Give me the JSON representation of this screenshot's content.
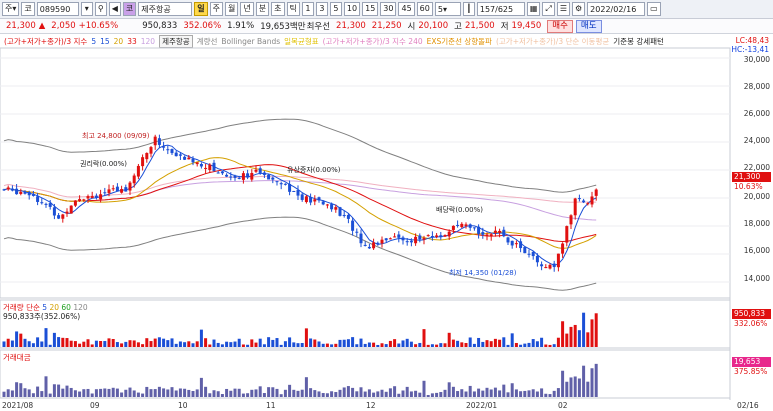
{
  "toolbar": {
    "market": "주",
    "code_prefix": "코",
    "code": "089590",
    "search_icon": "search-icon",
    "sound_icon": "speaker-icon",
    "badge": "코",
    "name": "제주항공",
    "periods": [
      "일",
      "주",
      "월",
      "년",
      "분",
      "초",
      "틱"
    ],
    "active_period": "일",
    "intervals": [
      "1",
      "3",
      "5",
      "10",
      "15",
      "30",
      "45",
      "60"
    ],
    "interval_value": "5",
    "count": "157/625",
    "date": "2022/02/16"
  },
  "infobar": {
    "price": "21,300",
    "change": "▲",
    "change_value": "2,050",
    "change_pct": "+10.65%",
    "volume": "950,833",
    "vol_pct": "352.06%",
    "turnover": "1.91%",
    "amount": "19,653백만",
    "pref": "최우선",
    "ask": "21,300",
    "bid": "21,250",
    "open_label": "시",
    "open": "20,100",
    "high_label": "고",
    "high": "21,500",
    "low_label": "저",
    "low": "19,450",
    "buy": "매수",
    "sell": "매도"
  },
  "legend": {
    "ma_title": "(고가+저가+종가)/3 지수",
    "ma_periods": [
      "5",
      "15",
      "20",
      "33",
      "120"
    ],
    "name_box": "제주항공",
    "items": [
      "계량선",
      "Bollinger Bands",
      "일목균형표",
      "(고가+저가+종가)/3 지수 240",
      "EXS기준선 상향돌파",
      "(고가+저가+종가)/3 단순 이동평균",
      "기준봉 강세패턴"
    ]
  },
  "right_labels": {
    "lc": "LC:48,43",
    "hc": "HC:-13,41"
  },
  "price_axis": [
    "30,000",
    "28,000",
    "26,000",
    "24,000",
    "22,000",
    "20,000",
    "18,000",
    "16,000",
    "14,000"
  ],
  "price_tag": {
    "price": "21,300",
    "pct": "10.63%"
  },
  "annotations": {
    "high": "최고 24,800 (09/09)",
    "low": "최저 14,350 (01/28)",
    "rights": "권리락(0.00%)",
    "rights2": "권리락(0.00%)",
    "dividend": "배당락(0.00%)",
    "inv": "유상증자(0.00%)"
  },
  "volume_panel": {
    "title": "거래량 단순",
    "periods": [
      "5",
      "20",
      "60",
      "120"
    ],
    "value": "950,833주(352.06%)",
    "tag_value": "950,833",
    "tag_pct": "332.06%"
  },
  "amount_panel": {
    "title": "거래대금",
    "tag_value": "19,653",
    "tag_pct": "375.85%"
  },
  "date_axis": [
    "2021/08",
    "09",
    "10",
    "11",
    "12",
    "2022/01",
    "02",
    "02/16"
  ],
  "colors": {
    "up": "#e01010",
    "down": "#1b4fd6",
    "accent": "#ffd94a"
  }
}
